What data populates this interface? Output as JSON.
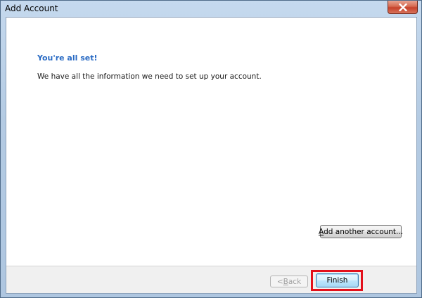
{
  "window": {
    "title": "Add Account"
  },
  "content": {
    "heading": "You're all set!",
    "message": "We have all the information we need to set up your account."
  },
  "buttons": {
    "add_another_prefix": "",
    "add_another_underlined": "A",
    "add_another_rest": "dd another account...",
    "back_prefix": "< ",
    "back_underlined": "B",
    "back_rest": "ack",
    "finish": "Finish"
  },
  "icons": {
    "close": "close-icon"
  },
  "colors": {
    "heading": "#2a6bc4",
    "highlight": "#e3101b",
    "close_button": "#c6412a"
  },
  "state": {
    "back_enabled": false,
    "highlighted_button": "Finish"
  }
}
